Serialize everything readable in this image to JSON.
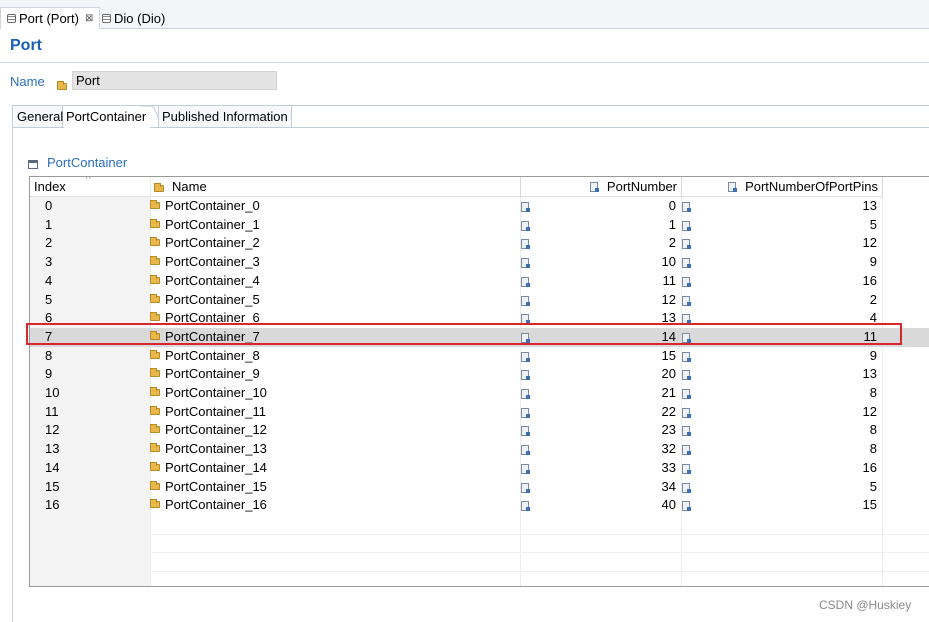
{
  "editor_tabs": [
    {
      "label": "Port (Port)",
      "close": "⊠"
    },
    {
      "label": "Dio (Dio)"
    }
  ],
  "page": {
    "title": "Port"
  },
  "name_field": {
    "label": "Name",
    "value": "Port"
  },
  "property_tabs": [
    "General",
    "PortContainer",
    "Published Information"
  ],
  "section": {
    "title": "PortContainer"
  },
  "table": {
    "headers": {
      "index": "Index",
      "name": "Name",
      "port_number": "PortNumber",
      "pins": "PortNumberOfPortPins"
    },
    "sort_indicator": "^",
    "rows": [
      {
        "index": "0",
        "name": "PortContainer_0",
        "port_number": "0",
        "pins": "13"
      },
      {
        "index": "1",
        "name": "PortContainer_1",
        "port_number": "1",
        "pins": "5"
      },
      {
        "index": "2",
        "name": "PortContainer_2",
        "port_number": "2",
        "pins": "12"
      },
      {
        "index": "3",
        "name": "PortContainer_3",
        "port_number": "10",
        "pins": "9"
      },
      {
        "index": "4",
        "name": "PortContainer_4",
        "port_number": "11",
        "pins": "16"
      },
      {
        "index": "5",
        "name": "PortContainer_5",
        "port_number": "12",
        "pins": "2"
      },
      {
        "index": "6",
        "name": "PortContainer_6",
        "port_number": "13",
        "pins": "4"
      },
      {
        "index": "7",
        "name": "PortContainer_7",
        "port_number": "14",
        "pins": "11",
        "selected": true
      },
      {
        "index": "8",
        "name": "PortContainer_8",
        "port_number": "15",
        "pins": "9"
      },
      {
        "index": "9",
        "name": "PortContainer_9",
        "port_number": "20",
        "pins": "13"
      },
      {
        "index": "10",
        "name": "PortContainer_10",
        "port_number": "21",
        "pins": "8"
      },
      {
        "index": "11",
        "name": "PortContainer_11",
        "port_number": "22",
        "pins": "12"
      },
      {
        "index": "12",
        "name": "PortContainer_12",
        "port_number": "23",
        "pins": "8"
      },
      {
        "index": "13",
        "name": "PortContainer_13",
        "port_number": "32",
        "pins": "8"
      },
      {
        "index": "14",
        "name": "PortContainer_14",
        "port_number": "33",
        "pins": "16"
      },
      {
        "index": "15",
        "name": "PortContainer_15",
        "port_number": "34",
        "pins": "5"
      },
      {
        "index": "16",
        "name": "PortContainer_16",
        "port_number": "40",
        "pins": "15"
      }
    ]
  },
  "annotation": {
    "color": "#d8262d"
  },
  "watermark": "CSDN @Huskiey",
  "colors": {
    "accent": "#1a5eb5",
    "link": "#2a6ebf",
    "selected_row": "#d9d9d9"
  }
}
